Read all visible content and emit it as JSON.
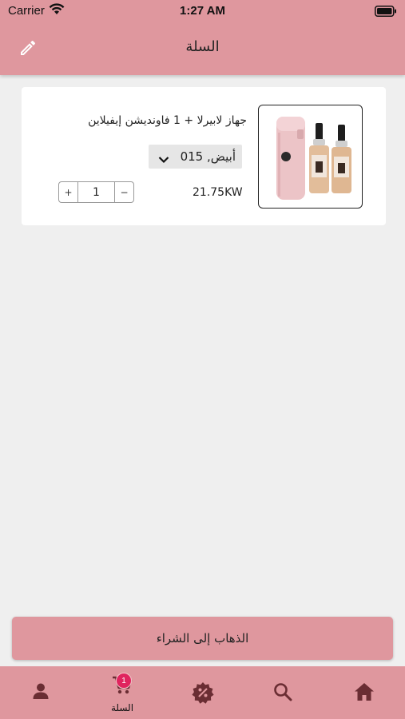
{
  "status_bar": {
    "carrier": "Carrier",
    "time": "1:27 AM"
  },
  "header": {
    "title": "السلة",
    "edit_icon": "pencil-icon"
  },
  "cart": {
    "items": [
      {
        "name": "جهاز لابيرلا + 1 فاونديشن إيفيلاين",
        "variant": "أبيض, 015",
        "price": "21.75KW",
        "quantity": "1",
        "plus_label": "+",
        "minus_label": "−"
      }
    ]
  },
  "checkout": {
    "label": "الذهاب إلى الشراء"
  },
  "tab_bar": {
    "cart_label": "السلة",
    "cart_badge": "1",
    "icons": [
      "user-icon",
      "cart-icon",
      "discount-icon",
      "search-icon",
      "home-icon"
    ]
  },
  "colors": {
    "accent": "#df979e",
    "badge": "#e0245e",
    "background": "#efefef"
  }
}
